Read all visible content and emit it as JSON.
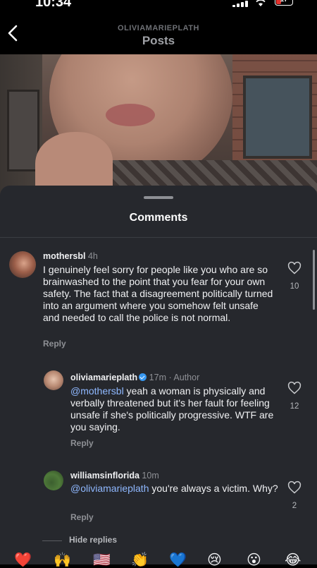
{
  "status_bar": {
    "time": "10:34",
    "battery": "17"
  },
  "header": {
    "username": "OLIVIAMARIEPLATH",
    "title": "Posts"
  },
  "sheet": {
    "title": "Comments"
  },
  "comments": [
    {
      "username": "mothersbl",
      "time": "4h",
      "text": "I genuinely feel sorry for people like you who are so brainwashed to the point that you fear for your own safety. The fact that a disagreement politically turned into an argument where you somehow felt unsafe and needed to call the police is not normal.",
      "reply_label": "Reply",
      "likes": "10"
    },
    {
      "username": "oliviamarieplath",
      "time": "17m",
      "badge": "Author",
      "mention": "@mothersbl",
      "text": " yeah a woman is physically and verbally threatened but it's her fault for feeling unsafe if she's politically progressive.  WTF are you saying.",
      "reply_label": "Reply",
      "likes": "12"
    },
    {
      "username": "williamsinflorida",
      "time": "10m",
      "mention": "@oliviamarieplath",
      "text": " you're always a victim. Why?",
      "reply_label": "Reply",
      "likes": "2"
    }
  ],
  "hide_replies": "Hide replies",
  "emoji_bar": [
    "❤️",
    "🙌",
    "🇺🇸",
    "👏",
    "💙",
    "😢",
    "😮",
    "😂"
  ]
}
